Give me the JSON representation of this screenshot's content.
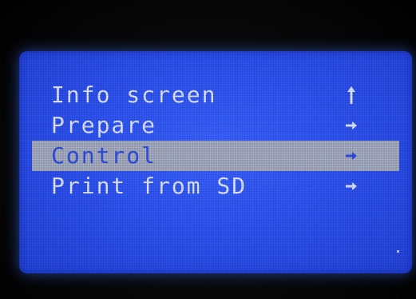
{
  "screen": {
    "menu": {
      "items": [
        {
          "label": "Info screen",
          "icon": "up-arrow-icon",
          "selected": false
        },
        {
          "label": "Prepare",
          "icon": "right-arrow-icon",
          "selected": false
        },
        {
          "label": "Control",
          "icon": "right-arrow-icon",
          "selected": true
        },
        {
          "label": "Print from SD",
          "icon": "right-arrow-icon",
          "selected": false
        }
      ]
    }
  },
  "colors": {
    "lcd_background": "#2f55f2",
    "text": "#dfe6ff",
    "selection_background": "#b3b9c8",
    "selected_text": "#2d4ee0",
    "bezel": "#050505"
  }
}
